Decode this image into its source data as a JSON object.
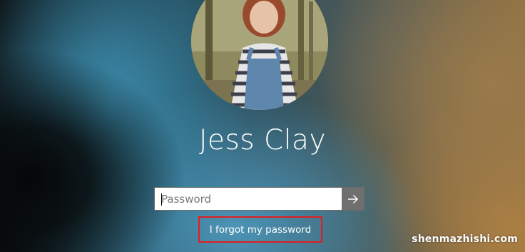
{
  "lock_screen": {
    "user_name": "Jess Clay",
    "password_placeholder": "Password",
    "password_value": "",
    "submit_icon": "arrow-right-icon",
    "forgot_password_label": "I forgot my password",
    "highlight_color": "#e01e1e"
  },
  "watermark": {
    "text": "shenmazhishi.com"
  }
}
